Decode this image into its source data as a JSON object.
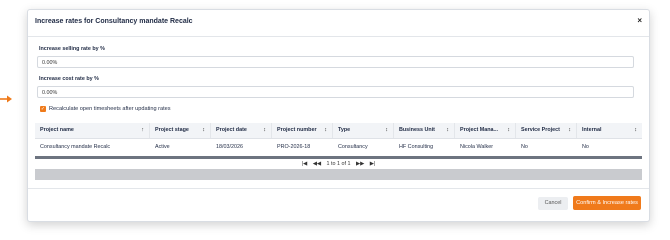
{
  "dialog": {
    "title": "Increase rates for Consultancy mandate Recalc",
    "close_label": "×"
  },
  "form": {
    "selling_rate_label": "Increase selling rate by %",
    "selling_rate_value": "0.00%",
    "cost_rate_label": "Increase cost rate by %",
    "cost_rate_value": "0.00%",
    "recalc_label": "Recalculate open timesheets after updating rates",
    "recalc_checked": true
  },
  "grid": {
    "columns": [
      {
        "label": "Project name",
        "sort": "↑"
      },
      {
        "label": "Project stage",
        "sort": "↕"
      },
      {
        "label": "Project date",
        "sort": "↕"
      },
      {
        "label": "Project number",
        "sort": "↕"
      },
      {
        "label": "Type",
        "sort": "↕"
      },
      {
        "label": "Business Unit",
        "sort": "↕"
      },
      {
        "label": "Project Mana...",
        "sort": "↕"
      },
      {
        "label": "Service Project",
        "sort": "↕"
      },
      {
        "label": "Internal",
        "sort": "↕"
      }
    ],
    "rows": [
      [
        "Consultancy mandate Recalc",
        "Active",
        "18/03/2026",
        "PRO-2026-18",
        "Consultancy",
        "HF Consulting",
        "Nicola Walker",
        "No",
        "No"
      ]
    ],
    "pager": {
      "first": "|◀",
      "prev": "◀◀",
      "text": "1 to 1 of 1",
      "next": "▶▶",
      "last": "▶|"
    }
  },
  "footer": {
    "cancel_label": "Cancel",
    "confirm_label": "Confirm & Increase rates"
  },
  "colors": {
    "accent": "#f07a1b",
    "title": "#1f2a44"
  }
}
